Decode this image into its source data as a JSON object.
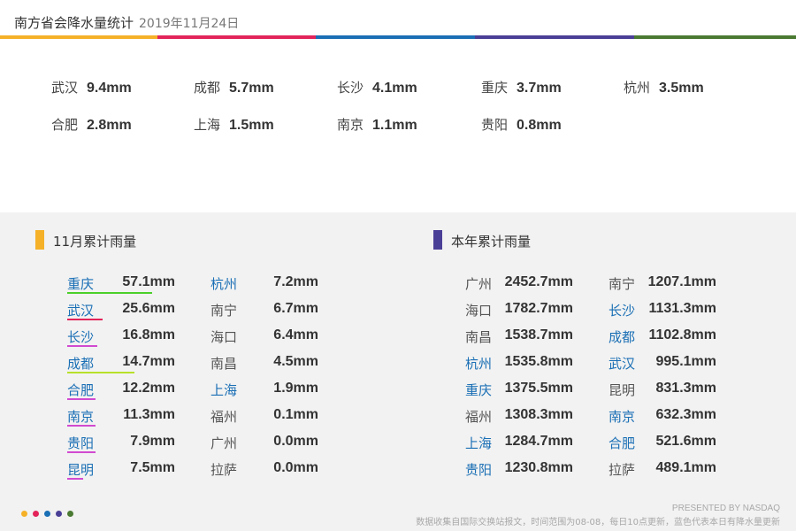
{
  "title": "南方省会降水量统计",
  "date": "2019年11月24日",
  "colors": {
    "orange": "#f5b128",
    "red": "#e3245a",
    "blue": "#1a6fb5",
    "purple": "#4a3f96",
    "green": "#4a7a32",
    "lime": "#b8e02a",
    "magenta": "#d14ad0",
    "bright_green": "#4bd02a"
  },
  "chart_data": [
    {
      "type": "table",
      "title": "",
      "categories": [
        "武汉",
        "成都",
        "长沙",
        "重庆",
        "杭州",
        "合肥",
        "上海",
        "南京",
        "贵阳"
      ],
      "values": [
        9.4,
        5.7,
        4.1,
        3.7,
        3.5,
        2.8,
        1.5,
        1.1,
        0.8
      ],
      "value_labels": [
        "9.4mm",
        "5.7mm",
        "4.1mm",
        "3.7mm",
        "3.5mm",
        "2.8mm",
        "1.5mm",
        "1.1mm",
        "0.8mm"
      ]
    },
    {
      "type": "table",
      "title": "11月累计雨量",
      "categories": [
        "重庆",
        "武汉",
        "长沙",
        "成都",
        "合肥",
        "南京",
        "贵阳",
        "昆明",
        "杭州",
        "南宁",
        "海口",
        "南昌",
        "上海",
        "福州",
        "广州",
        "拉萨"
      ],
      "values": [
        57.1,
        25.6,
        16.8,
        14.7,
        12.2,
        11.3,
        7.9,
        7.5,
        7.2,
        6.7,
        6.4,
        4.5,
        1.9,
        0.1,
        0.0,
        0.0
      ],
      "value_labels": [
        "57.1mm",
        "25.6mm",
        "16.8mm",
        "14.7mm",
        "12.2mm",
        "11.3mm",
        "7.9mm",
        "7.5mm",
        "7.2mm",
        "6.7mm",
        "6.4mm",
        "4.5mm",
        "1.9mm",
        "0.1mm",
        "0.0mm",
        "0.0mm"
      ],
      "highlighted": [
        "重庆",
        "武汉",
        "长沙",
        "成都",
        "合肥",
        "南京",
        "贵阳",
        "昆明",
        "杭州",
        "上海"
      ]
    },
    {
      "type": "table",
      "title": "本年累计雨量",
      "categories": [
        "广州",
        "海口",
        "南昌",
        "杭州",
        "重庆",
        "福州",
        "上海",
        "贵阳",
        "南宁",
        "长沙",
        "成都",
        "武汉",
        "昆明",
        "南京",
        "合肥",
        "拉萨"
      ],
      "values": [
        2452.7,
        1782.7,
        1538.7,
        1535.8,
        1375.5,
        1308.3,
        1284.7,
        1230.8,
        1207.1,
        1131.3,
        1102.8,
        995.1,
        831.3,
        632.3,
        521.6,
        489.1
      ],
      "value_labels": [
        "2452.7mm",
        "1782.7mm",
        "1538.7mm",
        "1535.8mm",
        "1375.5mm",
        "1308.3mm",
        "1284.7mm",
        "1230.8mm",
        "1207.1mm",
        "1131.3mm",
        "1102.8mm",
        "995.1mm",
        "831.3mm",
        "632.3mm",
        "521.6mm",
        "489.1mm"
      ],
      "highlighted": [
        "杭州",
        "重庆",
        "上海",
        "贵阳",
        "长沙",
        "成都",
        "武汉",
        "南京",
        "合肥"
      ]
    }
  ],
  "credit": "PRESENTED BY NASDAQ",
  "note": "数据收集自国际交换站报文，时间范围为08-08，每日10点更新，蓝色代表本日有降水量更新"
}
